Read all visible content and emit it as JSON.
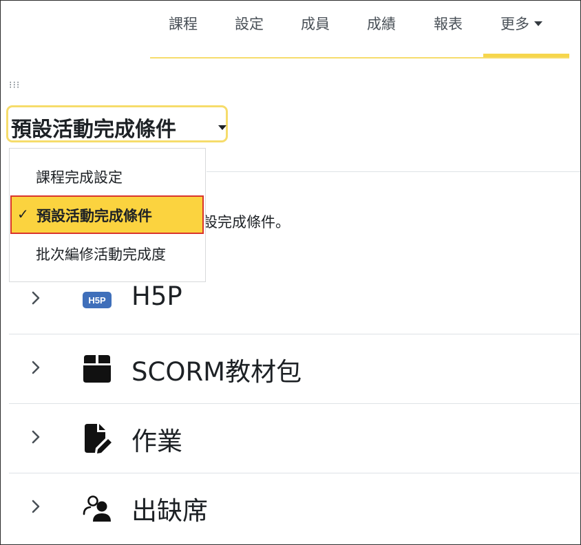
{
  "topnav": {
    "tabs": [
      "課程",
      "設定",
      "成員",
      "成績",
      "報表"
    ],
    "more_label": "更多"
  },
  "selector": {
    "current": "預設活動完成條件"
  },
  "dropdown": {
    "items": [
      {
        "label": "課程完成設定",
        "selected": false
      },
      {
        "label": "預設活動完成條件",
        "selected": true
      },
      {
        "label": "批次編修活動完成度",
        "selected": false
      }
    ]
  },
  "partial_text": "設完成條件。",
  "modules": [
    {
      "name": "H5P",
      "icon": "h5p-icon",
      "badge": "H5P"
    },
    {
      "name": "SCORM教材包",
      "icon": "box-icon"
    },
    {
      "name": "作業",
      "icon": "file-pen-icon"
    },
    {
      "name": "出缺席",
      "icon": "people-icon"
    }
  ],
  "colors": {
    "accent": "#f6dc6b",
    "highlight": "#fbd33f",
    "focus_border": "#d9342b",
    "h5p_blue": "#3f6fba"
  }
}
